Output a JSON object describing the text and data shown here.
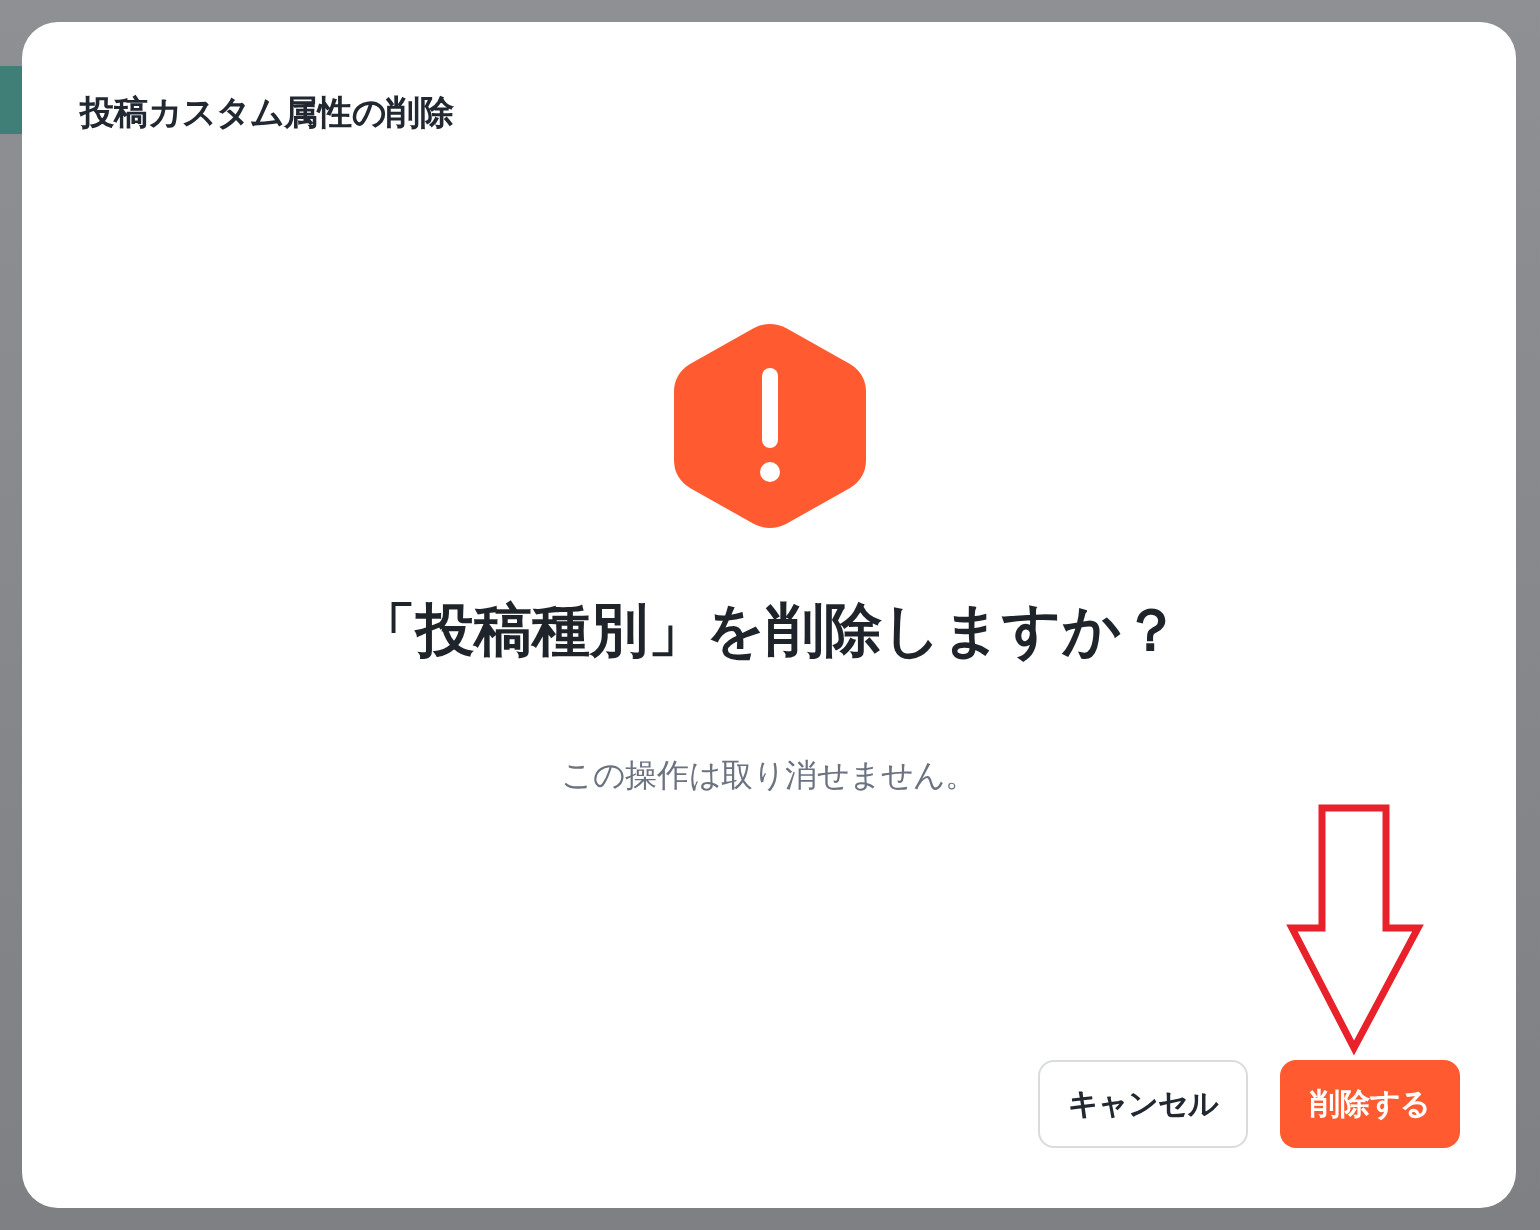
{
  "dialog": {
    "title": "投稿カスタム属性の削除",
    "heading": "「投稿種別」を削除しますか？",
    "message": "この操作は取り消せません。",
    "buttons": [
      {
        "label": "キャンセル",
        "kind": "secondary"
      },
      {
        "label": "削除する",
        "kind": "danger"
      }
    ]
  }
}
